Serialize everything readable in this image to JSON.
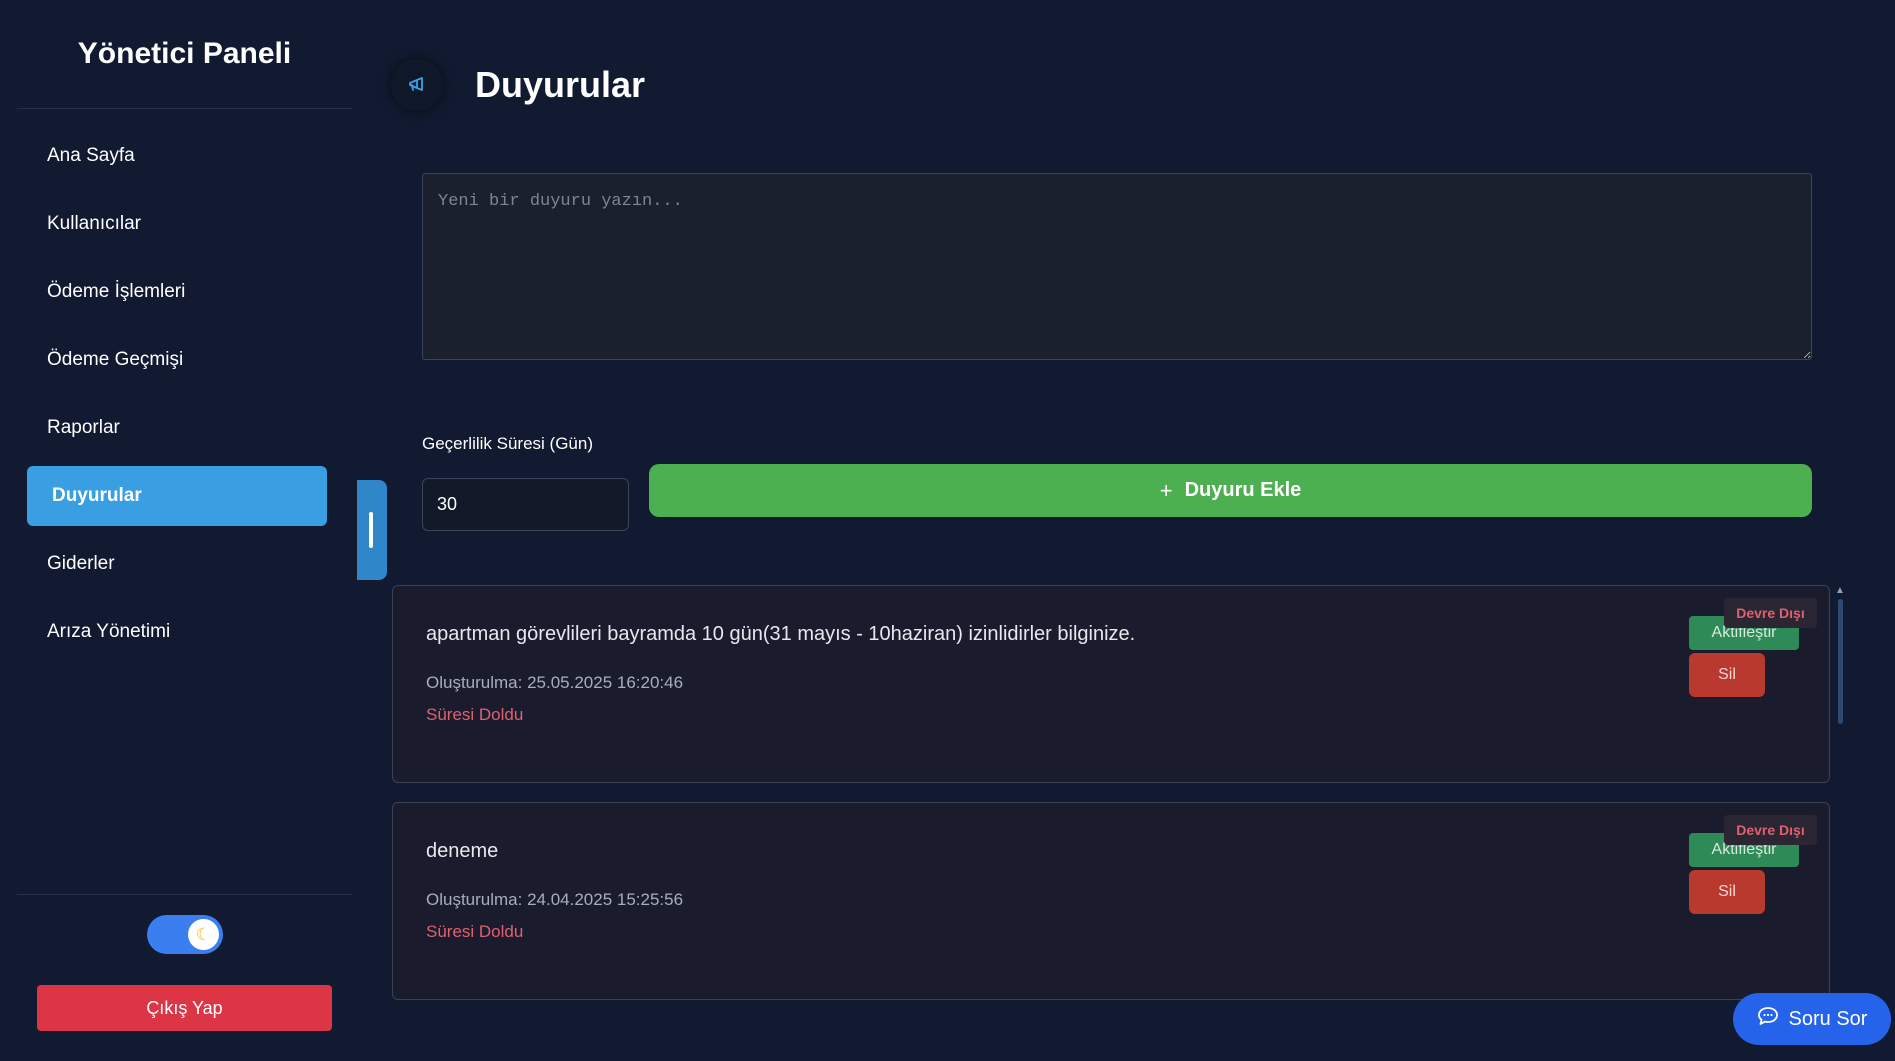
{
  "sidebar": {
    "title": "Yönetici Paneli",
    "items": [
      {
        "label": "Ana Sayfa"
      },
      {
        "label": "Kullanıcılar"
      },
      {
        "label": "Ödeme İşlemleri"
      },
      {
        "label": "Ödeme Geçmişi"
      },
      {
        "label": "Raporlar"
      },
      {
        "label": "Duyurular",
        "active": true
      },
      {
        "label": "Giderler"
      },
      {
        "label": "Arıza Yönetimi"
      }
    ],
    "theme_toggle": {
      "icon": "moon-icon",
      "on": true
    },
    "logout_label": "Çıkış Yap"
  },
  "header": {
    "icon": "megaphone-icon",
    "title": "Duyurular"
  },
  "form": {
    "placeholder": "Yeni bir duyuru yazın...",
    "duration_label": "Geçerlilik Süresi (Gün)",
    "duration_value": "30",
    "add_label": "Duyuru Ekle",
    "add_icon": "plus-icon"
  },
  "announcements": [
    {
      "text": "apartman görevlileri bayramda 10 gün(31 mayıs - 10haziran) izinlidirler bilginize.",
      "created": "Oluşturulma: 25.05.2025 16:20:46",
      "status": "Süresi Doldu",
      "badge": "Devre Dışı",
      "activate_label": "Aktifleştir",
      "delete_label": "Sil"
    },
    {
      "text": "deneme",
      "created": "Oluşturulma: 24.04.2025 15:25:56",
      "status": "Süresi Doldu",
      "badge": "Devre Dışı",
      "activate_label": "Aktifleştir",
      "delete_label": "Sil"
    }
  ],
  "chat": {
    "label": "Soru Sor",
    "icon": "chat-bubble-icon"
  },
  "colors": {
    "background": "#111a30",
    "accent": "#3a9ee2",
    "success": "#4caf50",
    "danger": "#dc3545",
    "chat": "#2563eb"
  }
}
